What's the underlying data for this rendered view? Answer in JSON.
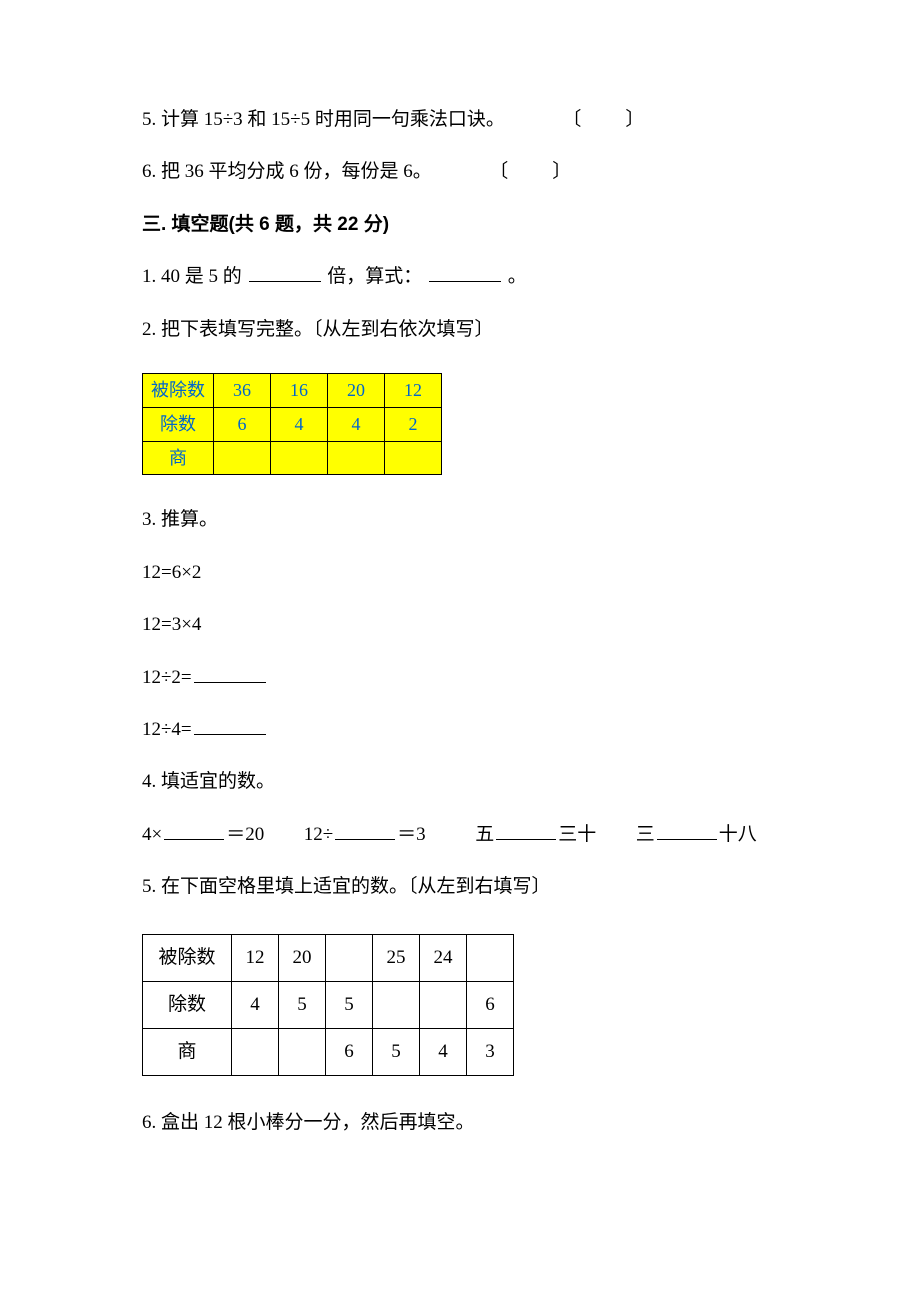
{
  "q5": {
    "num": "5.",
    "text": "计算 15÷3 和 15÷5 时用同一句乘法口诀。",
    "paren": "〔　　〕"
  },
  "q6": {
    "num": "6.",
    "text": "把 36 平均分成 6 份，每份是 6。",
    "paren": "〔　　〕"
  },
  "section3": {
    "title": "三. 填空题(共 6 题，共 22 分)"
  },
  "f1": {
    "num": "1.",
    "t1": "40 是 5 的",
    "t2": "倍，算式：",
    "t3": "。"
  },
  "f2": {
    "num": "2.",
    "text": "把下表填写完整。〔从左到右依次填写〕"
  },
  "ytable": {
    "h0": "被除数",
    "h1": "36",
    "h2": "16",
    "h3": "20",
    "h4": "12",
    "r0": "除数",
    "r1": "6",
    "r2": "4",
    "r3": "4",
    "r4": "2",
    "s0": "商",
    "s1": "",
    "s2": "",
    "s3": "",
    "s4": ""
  },
  "f3": {
    "num": "3.",
    "text": "推算。",
    "l1": "12=6×2",
    "l2": "12=3×4",
    "l3": "12÷2=",
    "l4": "12÷4="
  },
  "f4": {
    "num": "4.",
    "text": "填适宜的数。",
    "a1": "4×",
    "a2": "＝20",
    "b1": "12÷",
    "b2": "＝3",
    "c1": "五",
    "c2": "三十",
    "d1": "三",
    "d2": "十八"
  },
  "f5": {
    "num": "5.",
    "text": "在下面空格里填上适宜的数。〔从左到右填写〕"
  },
  "bwtable": {
    "h0": "被除数",
    "h1": "12",
    "h2": "20",
    "h3": "",
    "h4": "25",
    "h5": "24",
    "h6": "",
    "r0": "除数",
    "r1": "4",
    "r2": "5",
    "r3": "5",
    "r4": "",
    "r5": "",
    "r6": "6",
    "s0": "商",
    "s1": "",
    "s2": "",
    "s3": "6",
    "s4": "5",
    "s5": "4",
    "s6": "3"
  },
  "f6": {
    "num": "6.",
    "text": "盒出 12 根小棒分一分，然后再填空。"
  },
  "chart_data": [
    {
      "type": "table",
      "title": "division table (yellow)",
      "columns": [
        "被除数",
        "除数",
        "商"
      ],
      "rows": [
        {
          "被除数": 36,
          "除数": 6,
          "商": null
        },
        {
          "被除数": 16,
          "除数": 4,
          "商": null
        },
        {
          "被除数": 20,
          "除数": 4,
          "商": null
        },
        {
          "被除数": 12,
          "除数": 2,
          "商": null
        }
      ]
    },
    {
      "type": "table",
      "title": "division table (black/white)",
      "columns": [
        "被除数",
        "除数",
        "商"
      ],
      "rows": [
        {
          "被除数": 12,
          "除数": 4,
          "商": null
        },
        {
          "被除数": 20,
          "除数": 5,
          "商": null
        },
        {
          "被除数": null,
          "除数": 5,
          "商": 6
        },
        {
          "被除数": 25,
          "除数": null,
          "商": 5
        },
        {
          "被除数": 24,
          "除数": null,
          "商": 4
        },
        {
          "被除数": null,
          "除数": 6,
          "商": 3
        }
      ]
    }
  ]
}
